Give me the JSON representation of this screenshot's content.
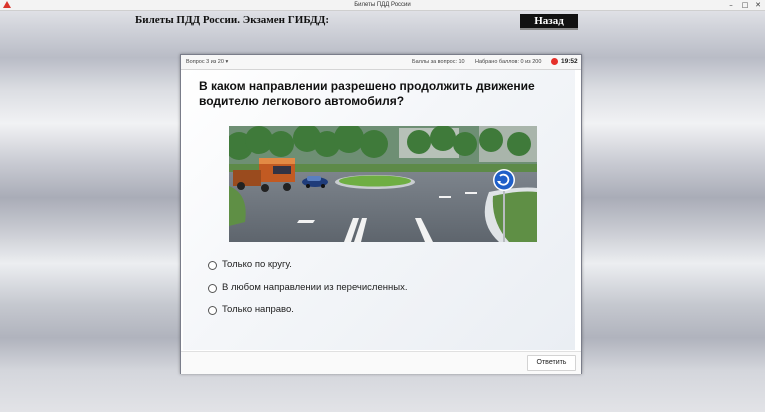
{
  "window": {
    "title": "Билеты ПДД России",
    "minimize": "–",
    "maximize": "□",
    "close": "✕"
  },
  "header": {
    "title": "Билеты ПДД России. Экзамен ГИБДД:",
    "back_label": "Назад"
  },
  "status": {
    "question_counter": "Вопрос 3 из 20 ▾",
    "points_per_question": "Баллы за вопрос: 10",
    "points_earned": "Набрано баллов: 0 из 200",
    "timer": "19:52"
  },
  "question": {
    "text": "В каком направлении разрешено продолжить движение водителю легкового автомобиля?",
    "image_icon": "roundabout-sign-icon"
  },
  "answers": [
    {
      "label": "Только по кругу."
    },
    {
      "label": "В любом направлении из перечисленных."
    },
    {
      "label": "Только направо."
    }
  ],
  "footer": {
    "submit_label": "Ответить"
  },
  "colors": {
    "timer_dot": "#e5302a",
    "sign_blue": "#1f5fc8",
    "truck": "#d46a2a"
  }
}
